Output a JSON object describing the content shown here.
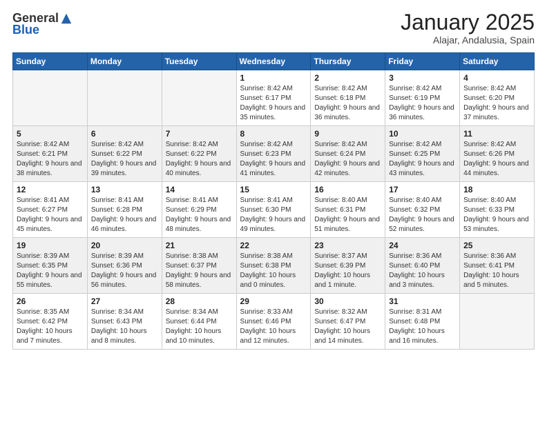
{
  "logo": {
    "general": "General",
    "blue": "Blue"
  },
  "header": {
    "month": "January 2025",
    "location": "Alajar, Andalusia, Spain"
  },
  "weekdays": [
    "Sunday",
    "Monday",
    "Tuesday",
    "Wednesday",
    "Thursday",
    "Friday",
    "Saturday"
  ],
  "weeks": [
    {
      "shaded": false,
      "days": [
        {
          "num": "",
          "info": ""
        },
        {
          "num": "",
          "info": ""
        },
        {
          "num": "",
          "info": ""
        },
        {
          "num": "1",
          "info": "Sunrise: 8:42 AM\nSunset: 6:17 PM\nDaylight: 9 hours and 35 minutes."
        },
        {
          "num": "2",
          "info": "Sunrise: 8:42 AM\nSunset: 6:18 PM\nDaylight: 9 hours and 36 minutes."
        },
        {
          "num": "3",
          "info": "Sunrise: 8:42 AM\nSunset: 6:19 PM\nDaylight: 9 hours and 36 minutes."
        },
        {
          "num": "4",
          "info": "Sunrise: 8:42 AM\nSunset: 6:20 PM\nDaylight: 9 hours and 37 minutes."
        }
      ]
    },
    {
      "shaded": true,
      "days": [
        {
          "num": "5",
          "info": "Sunrise: 8:42 AM\nSunset: 6:21 PM\nDaylight: 9 hours and 38 minutes."
        },
        {
          "num": "6",
          "info": "Sunrise: 8:42 AM\nSunset: 6:22 PM\nDaylight: 9 hours and 39 minutes."
        },
        {
          "num": "7",
          "info": "Sunrise: 8:42 AM\nSunset: 6:22 PM\nDaylight: 9 hours and 40 minutes."
        },
        {
          "num": "8",
          "info": "Sunrise: 8:42 AM\nSunset: 6:23 PM\nDaylight: 9 hours and 41 minutes."
        },
        {
          "num": "9",
          "info": "Sunrise: 8:42 AM\nSunset: 6:24 PM\nDaylight: 9 hours and 42 minutes."
        },
        {
          "num": "10",
          "info": "Sunrise: 8:42 AM\nSunset: 6:25 PM\nDaylight: 9 hours and 43 minutes."
        },
        {
          "num": "11",
          "info": "Sunrise: 8:42 AM\nSunset: 6:26 PM\nDaylight: 9 hours and 44 minutes."
        }
      ]
    },
    {
      "shaded": false,
      "days": [
        {
          "num": "12",
          "info": "Sunrise: 8:41 AM\nSunset: 6:27 PM\nDaylight: 9 hours and 45 minutes."
        },
        {
          "num": "13",
          "info": "Sunrise: 8:41 AM\nSunset: 6:28 PM\nDaylight: 9 hours and 46 minutes."
        },
        {
          "num": "14",
          "info": "Sunrise: 8:41 AM\nSunset: 6:29 PM\nDaylight: 9 hours and 48 minutes."
        },
        {
          "num": "15",
          "info": "Sunrise: 8:41 AM\nSunset: 6:30 PM\nDaylight: 9 hours and 49 minutes."
        },
        {
          "num": "16",
          "info": "Sunrise: 8:40 AM\nSunset: 6:31 PM\nDaylight: 9 hours and 51 minutes."
        },
        {
          "num": "17",
          "info": "Sunrise: 8:40 AM\nSunset: 6:32 PM\nDaylight: 9 hours and 52 minutes."
        },
        {
          "num": "18",
          "info": "Sunrise: 8:40 AM\nSunset: 6:33 PM\nDaylight: 9 hours and 53 minutes."
        }
      ]
    },
    {
      "shaded": true,
      "days": [
        {
          "num": "19",
          "info": "Sunrise: 8:39 AM\nSunset: 6:35 PM\nDaylight: 9 hours and 55 minutes."
        },
        {
          "num": "20",
          "info": "Sunrise: 8:39 AM\nSunset: 6:36 PM\nDaylight: 9 hours and 56 minutes."
        },
        {
          "num": "21",
          "info": "Sunrise: 8:38 AM\nSunset: 6:37 PM\nDaylight: 9 hours and 58 minutes."
        },
        {
          "num": "22",
          "info": "Sunrise: 8:38 AM\nSunset: 6:38 PM\nDaylight: 10 hours and 0 minutes."
        },
        {
          "num": "23",
          "info": "Sunrise: 8:37 AM\nSunset: 6:39 PM\nDaylight: 10 hours and 1 minute."
        },
        {
          "num": "24",
          "info": "Sunrise: 8:36 AM\nSunset: 6:40 PM\nDaylight: 10 hours and 3 minutes."
        },
        {
          "num": "25",
          "info": "Sunrise: 8:36 AM\nSunset: 6:41 PM\nDaylight: 10 hours and 5 minutes."
        }
      ]
    },
    {
      "shaded": false,
      "days": [
        {
          "num": "26",
          "info": "Sunrise: 8:35 AM\nSunset: 6:42 PM\nDaylight: 10 hours and 7 minutes."
        },
        {
          "num": "27",
          "info": "Sunrise: 8:34 AM\nSunset: 6:43 PM\nDaylight: 10 hours and 8 minutes."
        },
        {
          "num": "28",
          "info": "Sunrise: 8:34 AM\nSunset: 6:44 PM\nDaylight: 10 hours and 10 minutes."
        },
        {
          "num": "29",
          "info": "Sunrise: 8:33 AM\nSunset: 6:46 PM\nDaylight: 10 hours and 12 minutes."
        },
        {
          "num": "30",
          "info": "Sunrise: 8:32 AM\nSunset: 6:47 PM\nDaylight: 10 hours and 14 minutes."
        },
        {
          "num": "31",
          "info": "Sunrise: 8:31 AM\nSunset: 6:48 PM\nDaylight: 10 hours and 16 minutes."
        },
        {
          "num": "",
          "info": ""
        }
      ]
    }
  ]
}
